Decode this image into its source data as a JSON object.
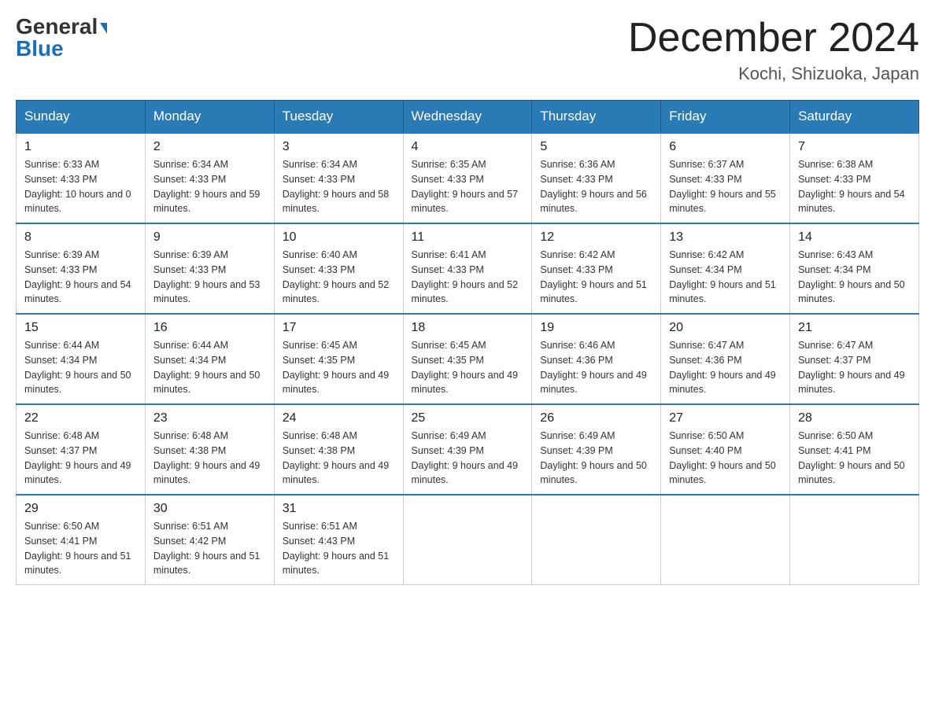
{
  "header": {
    "logo_line1": "General",
    "logo_line2": "Blue",
    "month_title": "December 2024",
    "location": "Kochi, Shizuoka, Japan"
  },
  "weekdays": [
    "Sunday",
    "Monday",
    "Tuesday",
    "Wednesday",
    "Thursday",
    "Friday",
    "Saturday"
  ],
  "weeks": [
    [
      {
        "day": "1",
        "sunrise": "6:33 AM",
        "sunset": "4:33 PM",
        "daylight": "10 hours and 0 minutes."
      },
      {
        "day": "2",
        "sunrise": "6:34 AM",
        "sunset": "4:33 PM",
        "daylight": "9 hours and 59 minutes."
      },
      {
        "day": "3",
        "sunrise": "6:34 AM",
        "sunset": "4:33 PM",
        "daylight": "9 hours and 58 minutes."
      },
      {
        "day": "4",
        "sunrise": "6:35 AM",
        "sunset": "4:33 PM",
        "daylight": "9 hours and 57 minutes."
      },
      {
        "day": "5",
        "sunrise": "6:36 AM",
        "sunset": "4:33 PM",
        "daylight": "9 hours and 56 minutes."
      },
      {
        "day": "6",
        "sunrise": "6:37 AM",
        "sunset": "4:33 PM",
        "daylight": "9 hours and 55 minutes."
      },
      {
        "day": "7",
        "sunrise": "6:38 AM",
        "sunset": "4:33 PM",
        "daylight": "9 hours and 54 minutes."
      }
    ],
    [
      {
        "day": "8",
        "sunrise": "6:39 AM",
        "sunset": "4:33 PM",
        "daylight": "9 hours and 54 minutes."
      },
      {
        "day": "9",
        "sunrise": "6:39 AM",
        "sunset": "4:33 PM",
        "daylight": "9 hours and 53 minutes."
      },
      {
        "day": "10",
        "sunrise": "6:40 AM",
        "sunset": "4:33 PM",
        "daylight": "9 hours and 52 minutes."
      },
      {
        "day": "11",
        "sunrise": "6:41 AM",
        "sunset": "4:33 PM",
        "daylight": "9 hours and 52 minutes."
      },
      {
        "day": "12",
        "sunrise": "6:42 AM",
        "sunset": "4:33 PM",
        "daylight": "9 hours and 51 minutes."
      },
      {
        "day": "13",
        "sunrise": "6:42 AM",
        "sunset": "4:34 PM",
        "daylight": "9 hours and 51 minutes."
      },
      {
        "day": "14",
        "sunrise": "6:43 AM",
        "sunset": "4:34 PM",
        "daylight": "9 hours and 50 minutes."
      }
    ],
    [
      {
        "day": "15",
        "sunrise": "6:44 AM",
        "sunset": "4:34 PM",
        "daylight": "9 hours and 50 minutes."
      },
      {
        "day": "16",
        "sunrise": "6:44 AM",
        "sunset": "4:34 PM",
        "daylight": "9 hours and 50 minutes."
      },
      {
        "day": "17",
        "sunrise": "6:45 AM",
        "sunset": "4:35 PM",
        "daylight": "9 hours and 49 minutes."
      },
      {
        "day": "18",
        "sunrise": "6:45 AM",
        "sunset": "4:35 PM",
        "daylight": "9 hours and 49 minutes."
      },
      {
        "day": "19",
        "sunrise": "6:46 AM",
        "sunset": "4:36 PM",
        "daylight": "9 hours and 49 minutes."
      },
      {
        "day": "20",
        "sunrise": "6:47 AM",
        "sunset": "4:36 PM",
        "daylight": "9 hours and 49 minutes."
      },
      {
        "day": "21",
        "sunrise": "6:47 AM",
        "sunset": "4:37 PM",
        "daylight": "9 hours and 49 minutes."
      }
    ],
    [
      {
        "day": "22",
        "sunrise": "6:48 AM",
        "sunset": "4:37 PM",
        "daylight": "9 hours and 49 minutes."
      },
      {
        "day": "23",
        "sunrise": "6:48 AM",
        "sunset": "4:38 PM",
        "daylight": "9 hours and 49 minutes."
      },
      {
        "day": "24",
        "sunrise": "6:48 AM",
        "sunset": "4:38 PM",
        "daylight": "9 hours and 49 minutes."
      },
      {
        "day": "25",
        "sunrise": "6:49 AM",
        "sunset": "4:39 PM",
        "daylight": "9 hours and 49 minutes."
      },
      {
        "day": "26",
        "sunrise": "6:49 AM",
        "sunset": "4:39 PM",
        "daylight": "9 hours and 50 minutes."
      },
      {
        "day": "27",
        "sunrise": "6:50 AM",
        "sunset": "4:40 PM",
        "daylight": "9 hours and 50 minutes."
      },
      {
        "day": "28",
        "sunrise": "6:50 AM",
        "sunset": "4:41 PM",
        "daylight": "9 hours and 50 minutes."
      }
    ],
    [
      {
        "day": "29",
        "sunrise": "6:50 AM",
        "sunset": "4:41 PM",
        "daylight": "9 hours and 51 minutes."
      },
      {
        "day": "30",
        "sunrise": "6:51 AM",
        "sunset": "4:42 PM",
        "daylight": "9 hours and 51 minutes."
      },
      {
        "day": "31",
        "sunrise": "6:51 AM",
        "sunset": "4:43 PM",
        "daylight": "9 hours and 51 minutes."
      },
      null,
      null,
      null,
      null
    ]
  ]
}
